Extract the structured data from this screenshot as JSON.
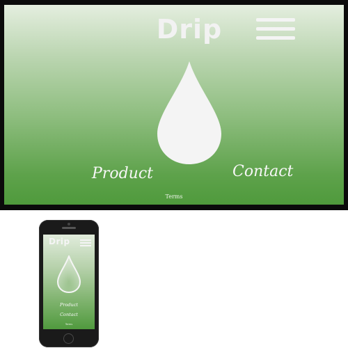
{
  "desktop": {
    "logo": "Drip",
    "menu_icon": "hamburger-icon",
    "hero_icon": "water-drop-icon",
    "nav": {
      "product": "Product",
      "contact": "Contact"
    },
    "footer": {
      "terms": "Terms"
    }
  },
  "mobile": {
    "logo": "Drip",
    "menu_icon": "hamburger-icon",
    "hero_icon": "water-drop-outline-icon",
    "nav": {
      "product": "Product",
      "contact": "Contact"
    },
    "footer": {
      "terms": "Terms"
    }
  },
  "colors": {
    "gradient_top": "#e4eedf",
    "gradient_bottom": "#4f9a3c",
    "text": "#f5f5f5"
  }
}
